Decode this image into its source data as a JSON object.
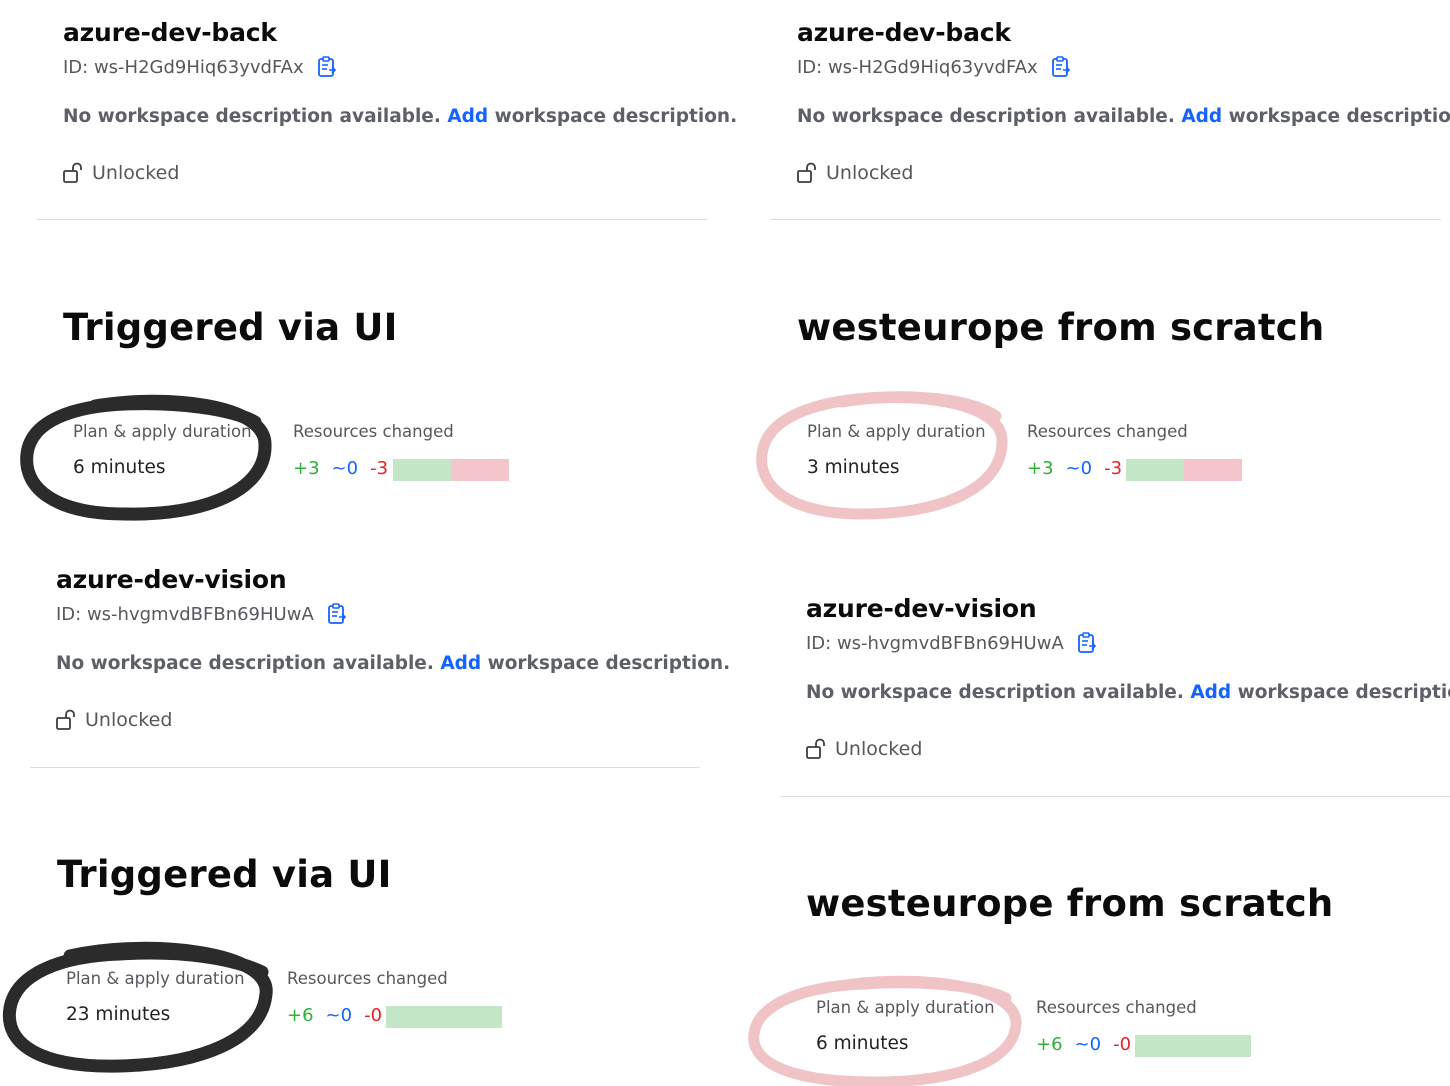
{
  "common": {
    "desc_prefix": "No workspace description available.",
    "desc_link": "Add",
    "desc_suffix": "workspace description.",
    "lock_status": "Unlocked",
    "duration_label": "Plan & apply duration",
    "resources_label": "Resources changed"
  },
  "left": {
    "workspaces": [
      {
        "name": "azure-dev-back",
        "id": "ID: ws-H2Gd9Hiq63yvdFAx"
      },
      {
        "name": "azure-dev-vision",
        "id": "ID: ws-hvgmvdBFBn69HUwA"
      }
    ],
    "runs": [
      {
        "title": "Triggered via UI",
        "duration": "6 minutes",
        "added": "+3",
        "changed": "~0",
        "destroyed": "-3",
        "bar_add_fraction": 0.5,
        "bar_destroy_fraction": 0.5
      },
      {
        "title": "Triggered via UI",
        "duration": "23 minutes",
        "added": "+6",
        "changed": "~0",
        "destroyed": "-0",
        "bar_add_fraction": 1.0,
        "bar_destroy_fraction": 0.0
      }
    ]
  },
  "right": {
    "workspaces": [
      {
        "name": "azure-dev-back",
        "id": "ID: ws-H2Gd9Hiq63yvdFAx"
      },
      {
        "name": "azure-dev-vision",
        "id": "ID: ws-hvgmvdBFBn69HUwA"
      }
    ],
    "runs": [
      {
        "title": "westeurope from scratch",
        "duration": "3 minutes",
        "added": "+3",
        "changed": "~0",
        "destroyed": "-3",
        "bar_add_fraction": 0.5,
        "bar_destroy_fraction": 0.5
      },
      {
        "title": "westeurope from scratch",
        "duration": "6 minutes",
        "added": "+6",
        "changed": "~0",
        "destroyed": "-0",
        "bar_add_fraction": 1.0,
        "bar_destroy_fraction": 0.0
      }
    ]
  },
  "colors": {
    "link": "#1563ff",
    "added": "#2eb039",
    "changed": "#1563ff",
    "destroyed": "#e52228",
    "bar_added": "#c3e6c7",
    "bar_destroyed": "#f2c6cb",
    "circle_left": "#2b2b2b",
    "circle_right": "#f0c4c6"
  },
  "icons": {
    "copy": "clipboard-copy-icon",
    "lock": "unlock-icon",
    "annotation": "hand-drawn-circle"
  }
}
